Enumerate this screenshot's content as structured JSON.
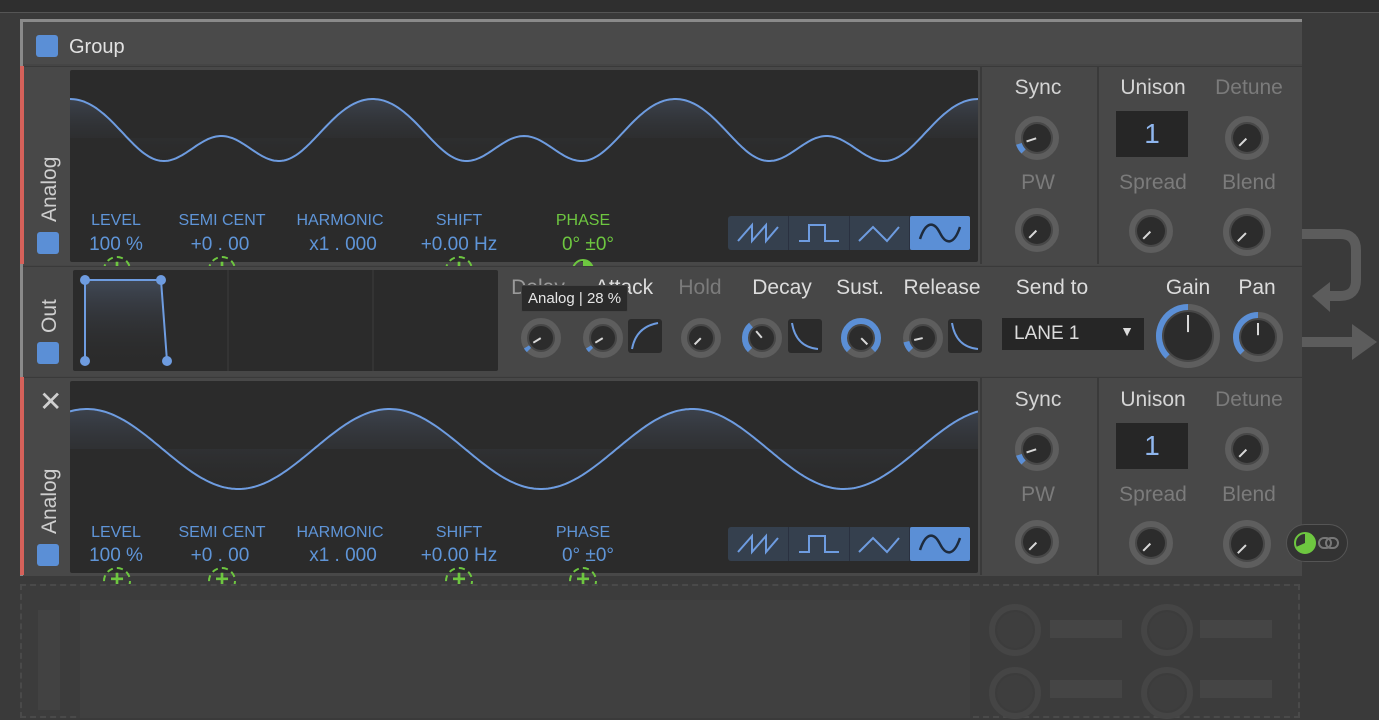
{
  "group": {
    "title": "Group"
  },
  "osc1": {
    "name": "Analog",
    "params": [
      {
        "label": "LEVEL",
        "value": "100 %"
      },
      {
        "label": "SEMI CENT",
        "value": "+0 . 00"
      },
      {
        "label": "HARMONIC",
        "value": "x1 . 000"
      },
      {
        "label": "SHIFT",
        "value": "+0.00 Hz"
      },
      {
        "label": "PHASE",
        "value": "0° ±0°"
      }
    ],
    "sync": "Sync",
    "pw": "PW",
    "unison": "Unison",
    "unison_value": "1",
    "detune": "Detune",
    "spread": "Spread",
    "blend": "Blend"
  },
  "out": {
    "name": "Out",
    "tooltip": "Analog | 28 %",
    "env_labels": [
      "Delay",
      "Attack",
      "Hold",
      "Decay",
      "Sust.",
      "Release"
    ],
    "send_to": "Send to",
    "send_value": "LANE 1",
    "gain": "Gain",
    "pan": "Pan"
  },
  "osc2": {
    "name": "Analog",
    "close": "✕",
    "params": [
      {
        "label": "LEVEL",
        "value": "100 %"
      },
      {
        "label": "SEMI CENT",
        "value": "+0 . 00"
      },
      {
        "label": "HARMONIC",
        "value": "x1 . 000"
      },
      {
        "label": "SHIFT",
        "value": "+0.00 Hz"
      },
      {
        "label": "PHASE",
        "value": "0° ±0°"
      }
    ],
    "sync": "Sync",
    "pw": "PW",
    "unison": "Unison",
    "unison_value": "1",
    "detune": "Detune",
    "spread": "Spread",
    "blend": "Blend"
  },
  "colors": {
    "accent": "#5b8fd6",
    "green": "#6ec740",
    "lane": "#d5615a"
  },
  "icons": [
    "saw-wave-icon",
    "square-wave-icon",
    "triangle-wave-icon",
    "sine-wave-icon",
    "plus-icon",
    "close-icon",
    "dropdown-arrow-icon",
    "return-arrow-icon",
    "phase-pie-icon",
    "link-icon"
  ]
}
